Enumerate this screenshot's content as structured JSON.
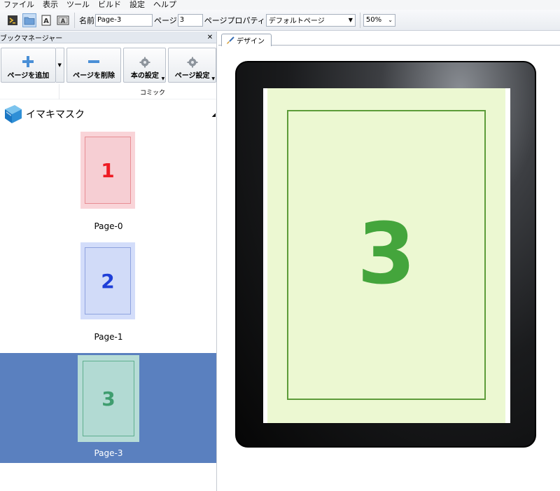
{
  "menu": [
    "ファイル",
    "表示",
    "ツール",
    "ビルド",
    "設定",
    "ヘルプ"
  ],
  "toolbar": {
    "name_label": "名前",
    "name_value": "Page-3",
    "page_label": "ページ",
    "page_value": "3",
    "page_property_label": "ページプロパティ",
    "page_property_value": "デフォルトページ",
    "zoom_value": "50%"
  },
  "left_panel": {
    "title": "ブックマネージャー",
    "buttons": {
      "add_page": "ページを追加",
      "delete_page": "ページを削除",
      "book_settings": "本の設定",
      "page_settings": "ページ設定"
    },
    "column_header": "コミック",
    "book_name": "イマキマスク",
    "pages": [
      {
        "number": "1",
        "label": "Page-0",
        "bg": "#f9d4d8",
        "inner_bg": "#f6ced3",
        "border": "#e88e94",
        "number_color": "#ee1c24"
      },
      {
        "number": "2",
        "label": "Page-1",
        "bg": "#d3ddfa",
        "inner_bg": "#d1dbf8",
        "border": "#8fa3df",
        "number_color": "#1f3fd8"
      },
      {
        "number": "3",
        "label": "Page-3",
        "bg": "#b6dcd6",
        "inner_bg": "#b2dad3",
        "border": "#5fae8e",
        "number_color": "#3f9d6f",
        "selected": true
      }
    ]
  },
  "design": {
    "tab_label": "デザイン",
    "page_number": "3",
    "colors": {
      "page_bg": "#ecf8d2",
      "frame": "#5d9c3a",
      "number": "#44a53c"
    }
  }
}
